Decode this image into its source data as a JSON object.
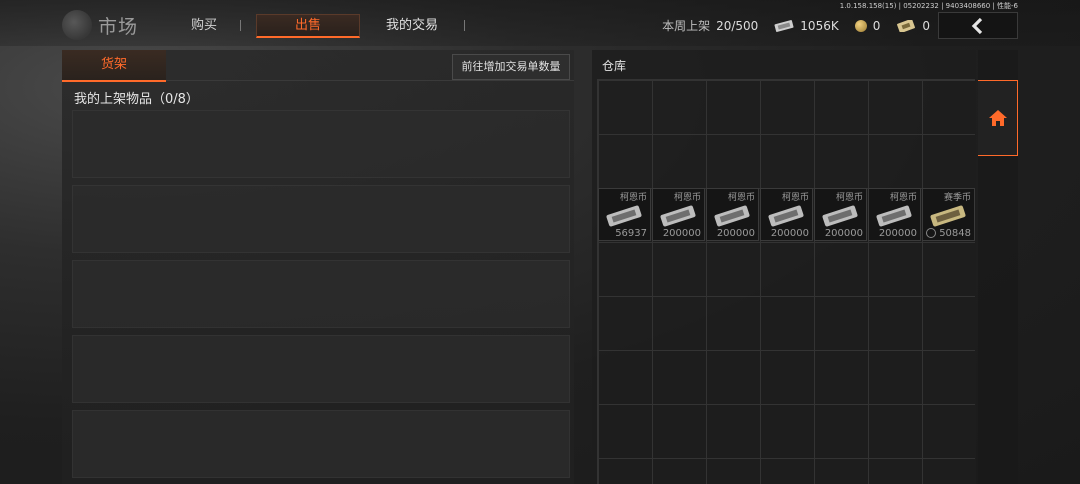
{
  "version": "1.0.158.158(15) | 05202232 | 9403408660 | 性能-6",
  "header": {
    "title": "市场",
    "tabs": [
      {
        "label": "购买",
        "active": false
      },
      {
        "label": "出售",
        "active": true
      },
      {
        "label": "我的交易",
        "active": false
      }
    ],
    "weekly_label": "本周上架",
    "weekly_value": "20/500",
    "currency1": "1056K",
    "currency2": "0",
    "currency3": "0"
  },
  "shelf": {
    "tab_label": "货架",
    "add_button": "前往增加交易单数量",
    "listed_title": "我的上架物品（0/8）"
  },
  "warehouse": {
    "title": "仓库",
    "items": [
      {
        "name": "柯恩币",
        "count": "56937",
        "locked": false
      },
      {
        "name": "柯恩币",
        "count": "200000",
        "locked": false
      },
      {
        "name": "柯恩币",
        "count": "200000",
        "locked": false
      },
      {
        "name": "柯恩币",
        "count": "200000",
        "locked": false
      },
      {
        "name": "柯恩币",
        "count": "200000",
        "locked": false
      },
      {
        "name": "柯恩币",
        "count": "200000",
        "locked": false
      },
      {
        "name": "赛季币",
        "count": "50848",
        "locked": true
      }
    ]
  },
  "colors": {
    "accent": "#ff6a2a",
    "background": "#1f1f1f"
  },
  "icons": {
    "back": "chevron-left-icon",
    "home": "home-icon",
    "cash": "cash-bundle-icon",
    "coin": "coin-icon",
    "ticket": "ticket-icon"
  }
}
